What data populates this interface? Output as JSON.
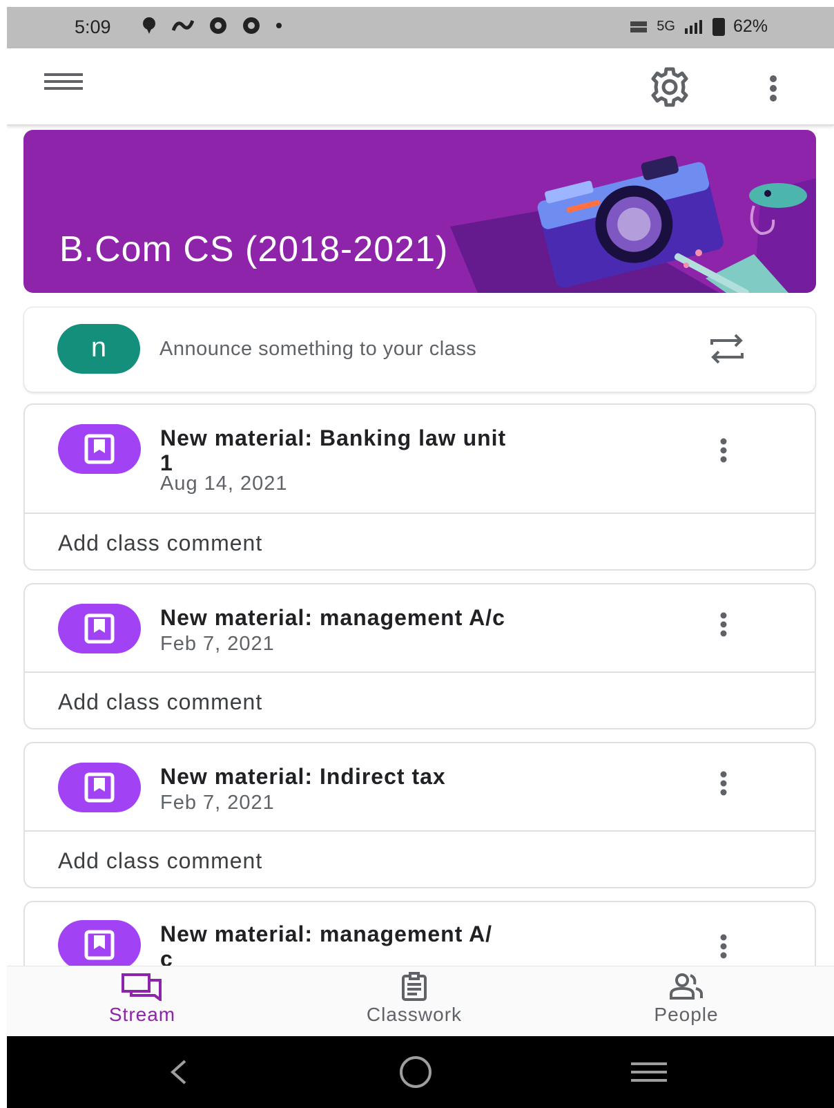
{
  "status_bar": {
    "time": "5:09",
    "network_label": "5G",
    "battery": "62%"
  },
  "app_bar": {
    "menu_icon": "hamburger-menu-icon",
    "settings_icon": "gear-icon",
    "more_icon": "more-vert-icon"
  },
  "banner": {
    "class_title": "B.Com  CS (2018-2021)",
    "color": "#8e24aa"
  },
  "announce": {
    "avatar_letter": "n",
    "placeholder": "Announce something to your class",
    "avatar_color": "#138f7b"
  },
  "stream": {
    "items": [
      {
        "title": "New material: Banking law unit 1",
        "title_line1": "New material: Banking law unit",
        "title_line2": "1",
        "date": "Aug 14, 2021",
        "comment": "Add class comment"
      },
      {
        "title": "New material: management A/c",
        "date": "Feb 7, 2021",
        "comment": "Add class comment"
      },
      {
        "title": "New material: Indirect tax",
        "date": "Feb 7, 2021",
        "comment": "Add class comment"
      },
      {
        "title_line1": "New material: management  A/",
        "title_line2": "c"
      }
    ],
    "icon_color": "#a142f4"
  },
  "bottom_nav": {
    "tabs": [
      {
        "label": "Stream",
        "active": true
      },
      {
        "label": "Classwork",
        "active": false
      },
      {
        "label": "People",
        "active": false
      }
    ],
    "active_color": "#8e24aa"
  }
}
